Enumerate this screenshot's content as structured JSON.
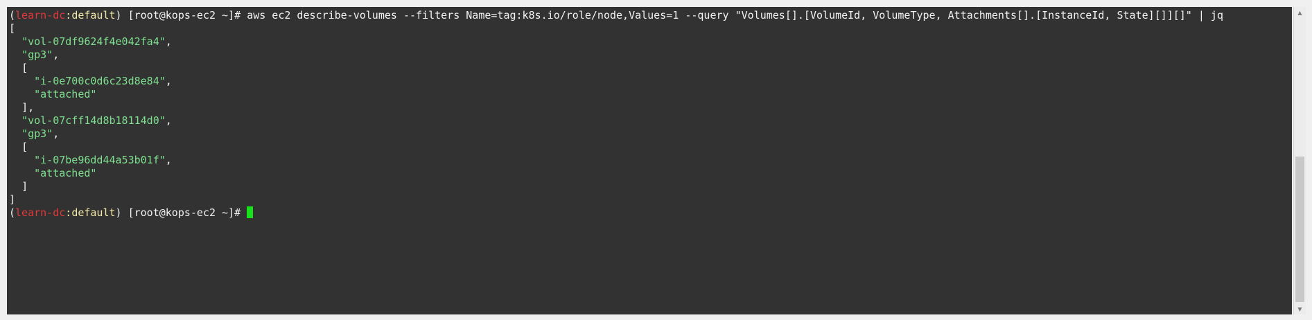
{
  "terminal": {
    "prompt": {
      "open": "(",
      "context": "learn-dc",
      "sep": ":",
      "namespace": "default",
      "close": ")",
      "user_host": " [root@kops-ec2 ~]# "
    },
    "command": "aws ec2 describe-volumes --filters Name=tag:k8s.io/role/node,Values=1 --query \"Volumes[].[VolumeId, VolumeType, Attachments[].[InstanceId, State][]][]\" | jq",
    "output": [
      {
        "indent": "",
        "text": "[",
        "kind": "punc"
      },
      {
        "indent": "  ",
        "text": "\"vol-07df9624f4e042fa4\"",
        "suffix": ",",
        "kind": "str"
      },
      {
        "indent": "  ",
        "text": "\"gp3\"",
        "suffix": ",",
        "kind": "str"
      },
      {
        "indent": "  ",
        "text": "[",
        "kind": "punc"
      },
      {
        "indent": "    ",
        "text": "\"i-0e700c0d6c23d8e84\"",
        "suffix": ",",
        "kind": "str"
      },
      {
        "indent": "    ",
        "text": "\"attached\"",
        "suffix": "",
        "kind": "str"
      },
      {
        "indent": "  ",
        "text": "],",
        "kind": "punc"
      },
      {
        "indent": "  ",
        "text": "\"vol-07cff14d8b18114d0\"",
        "suffix": ",",
        "kind": "str"
      },
      {
        "indent": "  ",
        "text": "\"gp3\"",
        "suffix": ",",
        "kind": "str"
      },
      {
        "indent": "  ",
        "text": "[",
        "kind": "punc"
      },
      {
        "indent": "    ",
        "text": "\"i-07be96dd44a53b01f\"",
        "suffix": ",",
        "kind": "str"
      },
      {
        "indent": "    ",
        "text": "\"attached\"",
        "suffix": "",
        "kind": "str"
      },
      {
        "indent": "  ",
        "text": "]",
        "kind": "punc"
      },
      {
        "indent": "",
        "text": "]",
        "kind": "punc"
      }
    ]
  },
  "scrollbar": {
    "up_icon": "arrow-up",
    "down_icon": "arrow-down",
    "up_glyph": "▲",
    "down_glyph": "▼"
  },
  "colors": {
    "background": "#323232",
    "context": "#e0393b",
    "namespace": "#f2e8a8",
    "json_string": "#7ee08f",
    "cursor": "#18e01a"
  }
}
